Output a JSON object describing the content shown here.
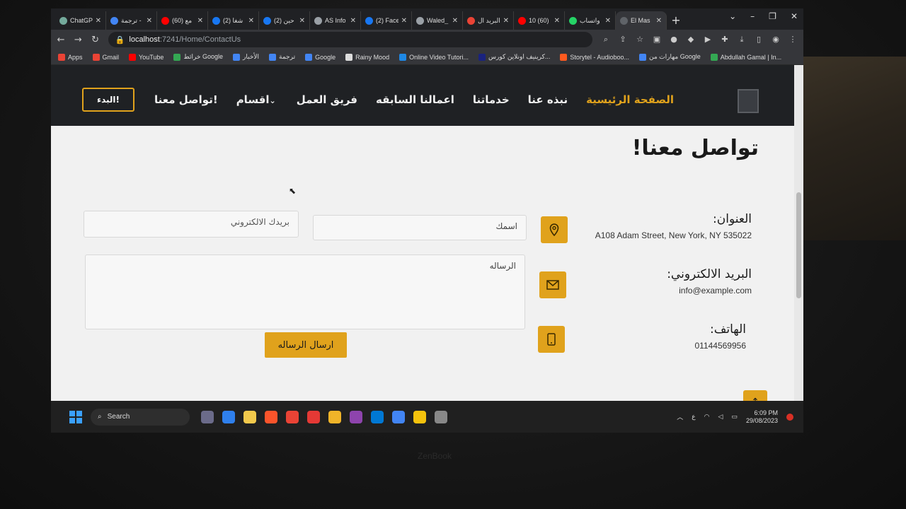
{
  "browser": {
    "tabs": [
      {
        "title": "ChatGP",
        "color": "#74aa9c"
      },
      {
        "title": "ترجمة -",
        "color": "#4285f4"
      },
      {
        "title": "(60) مع",
        "color": "#ff0000"
      },
      {
        "title": "(2) شغا",
        "color": "#1877f2"
      },
      {
        "title": "(2) حين",
        "color": "#1877f2"
      },
      {
        "title": "AS Info",
        "color": "#9aa0a6"
      },
      {
        "title": "(2) Face",
        "color": "#1877f2"
      },
      {
        "title": "Waled_",
        "color": "#9aa0a6"
      },
      {
        "title": "البريد ال",
        "color": "#ea4335"
      },
      {
        "title": "10 (60)",
        "color": "#ff0000"
      },
      {
        "title": "واتساب",
        "color": "#25d366"
      },
      {
        "title": "El Mas",
        "color": "#5f6368",
        "active": true
      }
    ],
    "address": {
      "host": "localhost",
      "path": ":7241/Home/ContactUs"
    },
    "bookmarks": [
      {
        "label": "Apps",
        "color": "#ea4335"
      },
      {
        "label": "Gmail",
        "color": "#ea4335"
      },
      {
        "label": "YouTube",
        "color": "#ff0000"
      },
      {
        "label": "خرائط Google",
        "color": "#34a853"
      },
      {
        "label": "الأخبار",
        "color": "#4285f4"
      },
      {
        "label": "ترجمة",
        "color": "#4285f4"
      },
      {
        "label": "Google",
        "color": "#4285f4"
      },
      {
        "label": "Rainy Mood",
        "color": "#dddddd"
      },
      {
        "label": "Online Video Tutori...",
        "color": "#1e88e5"
      },
      {
        "label": "كرينيف اونلاين كورس...",
        "color": "#1a237e"
      },
      {
        "label": "Storytel - Audioboo...",
        "color": "#ff5a1f"
      },
      {
        "label": "مهارات من Google",
        "color": "#4285f4"
      },
      {
        "label": "Abdullah Gamal | In...",
        "color": "#34a853"
      }
    ]
  },
  "site": {
    "nav": {
      "links": [
        "الصفحة الرئيسية",
        "نبذه عنا",
        "خدماتنا",
        "اعمالنا السابقه",
        "فريق العمل",
        "اقسام",
        "تواصل معنا!"
      ],
      "start_label": "البدء!"
    },
    "title": "تواصل معنا!",
    "contact": {
      "address_label": "العنوان:",
      "address_value": "A108 Adam Street, New York, NY 535022",
      "email_label": "البريد الالكتروني:",
      "email_value": "info@example.com",
      "phone_label": "الهاتف:",
      "phone_value": "01144569956"
    },
    "form": {
      "name_value": "اسمك",
      "email_placeholder": "بريدك الالكتروني",
      "message_placeholder": "الرساله",
      "send_label": "ارسال الرساله"
    },
    "accent": "#e0a21c"
  },
  "taskbar": {
    "search_label": "Search",
    "time": "6:09 PM",
    "date": "29/08/2023",
    "lang": "ع"
  }
}
